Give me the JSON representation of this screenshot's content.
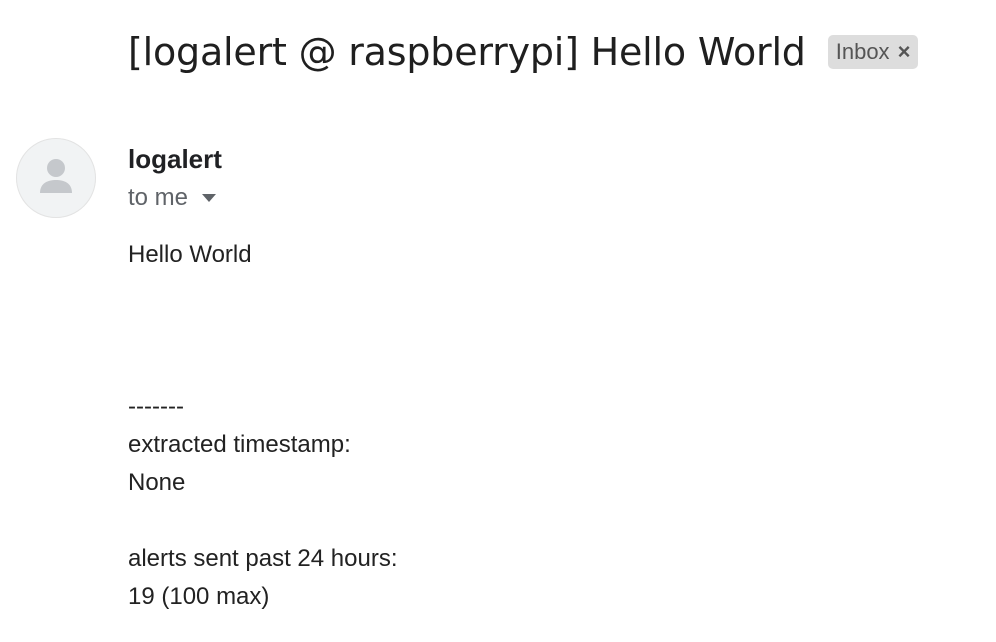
{
  "email": {
    "subject": "[logalert @ raspberrypi] Hello World",
    "label": "Inbox",
    "label_close": "×",
    "sender": "logalert",
    "recipient": "to me",
    "body_lines": [
      "Hello World",
      "",
      "",
      "",
      "-------",
      "extracted timestamp:",
      "None",
      "",
      "alerts sent past 24 hours:",
      "19 (100 max)"
    ]
  },
  "icons": {
    "avatar": "person-icon",
    "recipient_details": "caret-down-icon",
    "label_remove": "close-icon"
  },
  "colors": {
    "label_chip_bg": "#dddddd",
    "avatar_bg": "#f1f3f4",
    "avatar_glyph": "#c5c8cc",
    "muted_text": "#5f6368"
  }
}
